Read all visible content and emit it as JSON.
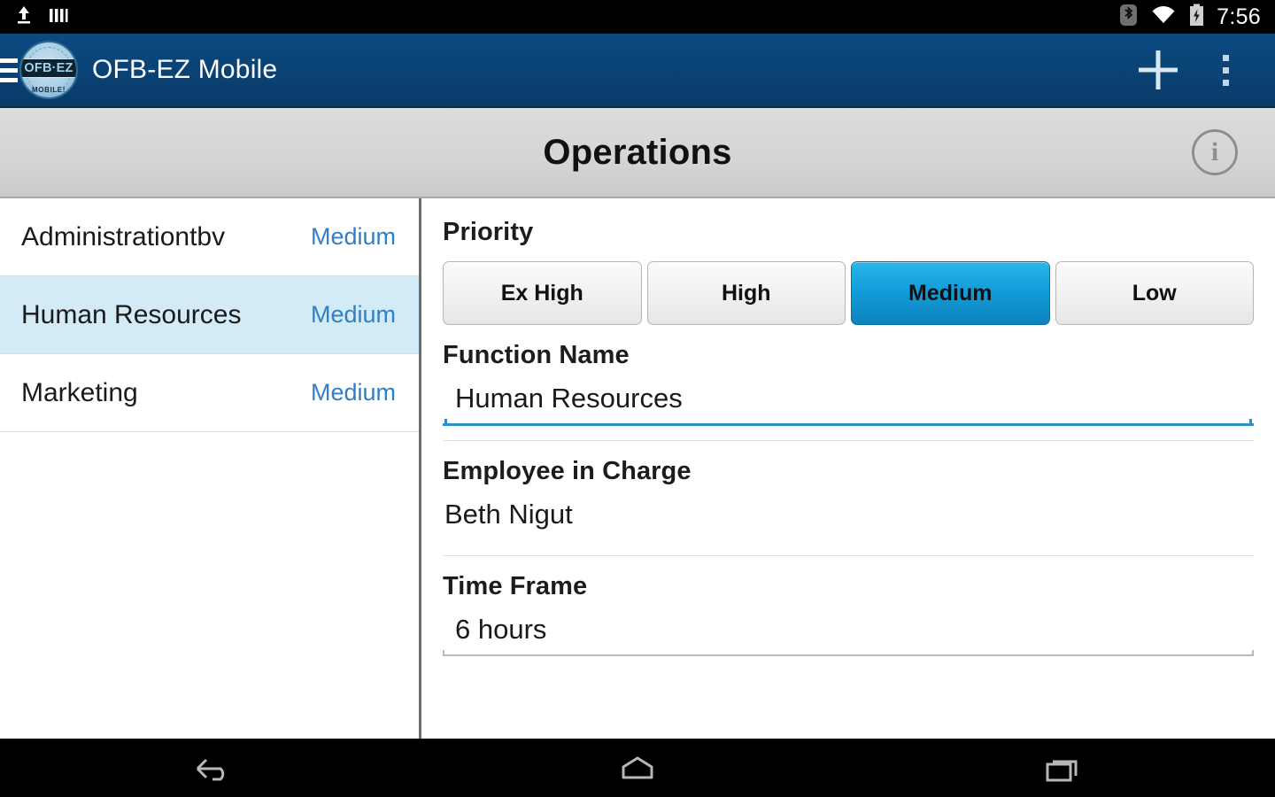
{
  "status_bar": {
    "upload_icon": "upload-icon",
    "bars_icon": "signal-bars-icon",
    "bluetooth_icon": "bluetooth-icon",
    "wifi_icon": "wifi-icon",
    "battery_icon": "battery-charging-icon",
    "clock": "7:56"
  },
  "app_bar": {
    "menu_icon": "hamburger-menu-icon",
    "logo_text": "OFB·EZ",
    "logo_sub": "MOBILE!",
    "title": "OFB-EZ Mobile",
    "add_icon": "plus-icon",
    "overflow_icon": "overflow-menu-icon",
    "background_color": "#0a4274"
  },
  "page_header": {
    "title": "Operations",
    "info_icon": "info-icon",
    "info_glyph": "i",
    "background_color": "#d4d4d4"
  },
  "list_pane": {
    "selected_index": 1,
    "items": [
      {
        "name": "Administrationtbv",
        "priority": "Medium"
      },
      {
        "name": "Human Resources",
        "priority": "Medium"
      },
      {
        "name": "Marketing",
        "priority": "Medium"
      }
    ],
    "priority_color": "#2f80c4",
    "selected_color": "#d3eaf7"
  },
  "detail_pane": {
    "priority": {
      "label": "Priority",
      "options": [
        "Ex High",
        "High",
        "Medium",
        "Low"
      ],
      "selected": "Medium",
      "selected_index": 2,
      "accent_color": "#14a0dd"
    },
    "function_name": {
      "label": "Function Name",
      "value": "Human Resources",
      "underline_color": "#2b8fcc"
    },
    "employee_in_charge": {
      "label": "Employee in Charge",
      "value": "Beth Nigut"
    },
    "time_frame": {
      "label": "Time Frame",
      "value": "6 hours",
      "underline_color": "#b9b9b9"
    }
  },
  "nav_bar": {
    "back_icon": "back-arrow-icon",
    "home_icon": "home-icon",
    "recents_icon": "recent-apps-icon"
  }
}
